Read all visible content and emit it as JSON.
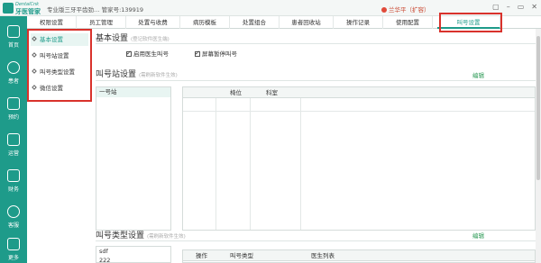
{
  "titlebar": {
    "logo_line1": "DentalCnk",
    "logo_line2": "牙医管家",
    "clinic": "专业版三牙平齿劲…  管家号:139919",
    "user": "兰华平（扩容）",
    "window_buttons": [
      "▢",
      "–",
      "▭",
      "✕"
    ]
  },
  "sidebar": [
    {
      "label": "首页",
      "icon": "home-icon"
    },
    {
      "label": "患者",
      "icon": "user-icon"
    },
    {
      "label": "预约",
      "icon": "calendar-icon"
    },
    {
      "label": "运营",
      "icon": "chart-icon"
    },
    {
      "label": "财务",
      "icon": "finance-icon"
    },
    {
      "label": "客服",
      "icon": "service-icon"
    },
    {
      "label": "更多",
      "icon": "more-icon"
    }
  ],
  "tabs": [
    {
      "label": "权限设置",
      "active": false
    },
    {
      "label": "员工管理",
      "active": false
    },
    {
      "label": "处置与收费",
      "active": false
    },
    {
      "label": "病历模板",
      "active": false
    },
    {
      "label": "处置组合",
      "active": false
    },
    {
      "label": "患者回收站",
      "active": false
    },
    {
      "label": "操作记录",
      "active": false
    },
    {
      "label": "使用配置",
      "active": false
    },
    {
      "label": "叫号设置",
      "active": true
    }
  ],
  "submenu": [
    {
      "label": "基本设置",
      "active": true
    },
    {
      "label": "叫号站设置",
      "active": false
    },
    {
      "label": "叫号类型设置",
      "active": false
    },
    {
      "label": "微信设置",
      "active": false
    }
  ],
  "basic": {
    "title": "基本设置",
    "hint": "(登记软件医生端)",
    "opt1": "启用医生叫号",
    "opt2": "屏幕暂停叫号",
    "opt1_checked": true,
    "opt2_checked": true
  },
  "station": {
    "title": "叫号站设置",
    "hint": "(需刷新软件生效)",
    "edit": "编辑",
    "list": [
      "一号站"
    ],
    "columns": [
      "椅位",
      "科室"
    ]
  },
  "type": {
    "title": "叫号类型设置",
    "hint": "(需刷新软件生效)",
    "edit": "编辑",
    "list": [
      "sdf",
      "222"
    ],
    "columns": [
      "操作",
      "叫号类型",
      "医生列表"
    ]
  },
  "colors": {
    "accent": "#1e9b8a",
    "highlight": "#d9322c",
    "edit": "#2c9a55"
  }
}
